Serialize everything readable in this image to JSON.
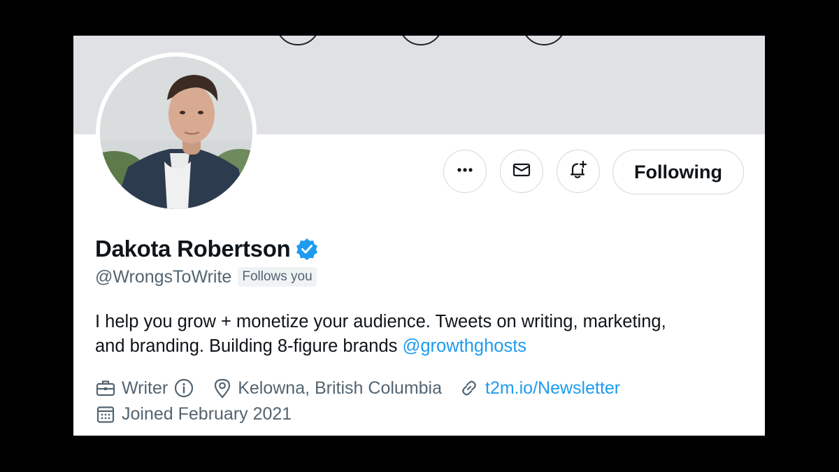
{
  "profile": {
    "display_name": "Dakota Robertson",
    "verified": true,
    "handle": "@WrongsToWrite",
    "follows_you_badge": "Follows you",
    "bio": {
      "line1": "I help you grow + monetize your audience. Tweets on writing, marketing,",
      "line2_prefix": "and branding. Building 8-figure brands ",
      "line2_mention": "@growthghosts"
    },
    "profession": "Writer",
    "location": "Kelowna, British Columbia",
    "website": "t2m.io/Newsletter",
    "joined": "Joined February 2021"
  },
  "actions": {
    "more_icon": "more-horizontal-icon",
    "message_icon": "envelope-icon",
    "notify_icon": "bell-plus-icon",
    "follow_label": "Following"
  },
  "colors": {
    "accent": "#1d9bf0",
    "text_primary": "#0f1419",
    "text_secondary": "#536471",
    "banner": "#e0e1e4",
    "border": "#cfd9de"
  }
}
